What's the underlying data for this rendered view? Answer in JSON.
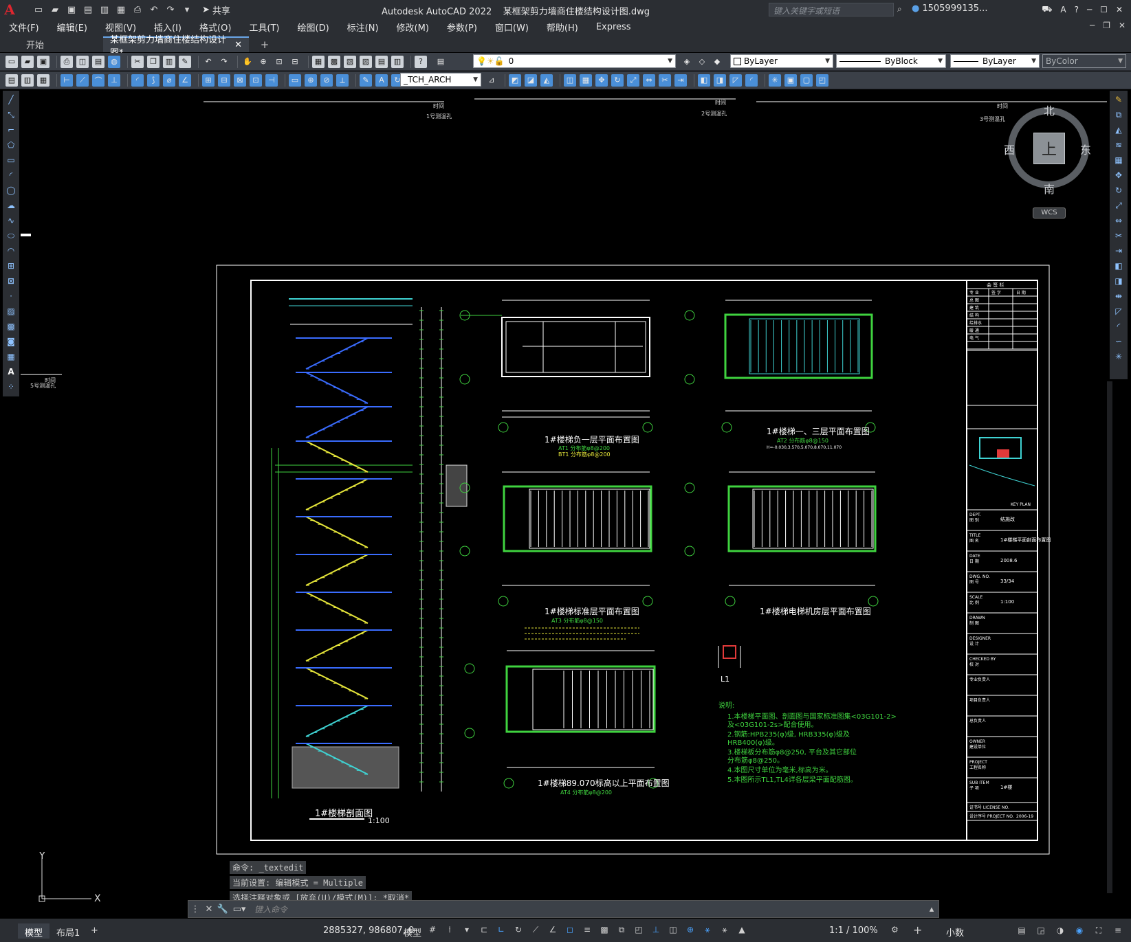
{
  "app": {
    "logo": "A",
    "title": "Autodesk AutoCAD 2022",
    "filename": "某框架剪力墙商住楼结构设计图.dwg",
    "share_label": "共享",
    "search_placeholder": "键入关键字或短语",
    "user": "1505999135..."
  },
  "menu": [
    "文件(F)",
    "编辑(E)",
    "视图(V)",
    "插入(I)",
    "格式(O)",
    "工具(T)",
    "绘图(D)",
    "标注(N)",
    "修改(M)",
    "参数(P)",
    "窗口(W)",
    "帮助(H)",
    "Express"
  ],
  "tabs": {
    "start": "开始",
    "active": "某框架剪力墙商住楼结构设计图*",
    "close": "✕",
    "add": "+"
  },
  "toolbar": {
    "layer_value": "0",
    "text_style": "_TCH_ARCH",
    "color": "ByLayer",
    "linetype": "ByBlock",
    "lineweight": "ByLayer",
    "plotstyle": "ByColor"
  },
  "viewcube": {
    "north": "北",
    "south": "南",
    "east": "东",
    "west": "西",
    "top": "上",
    "wcs": "WCS"
  },
  "drawing": {
    "ruler_labels": [
      "1号测温孔",
      "2号测温孔",
      "3号测温孔",
      "5号测温孔"
    ],
    "ruler_time": "时间",
    "section_title": "1#楼梯剖面图",
    "section_scale": "1:100",
    "plans": [
      {
        "title": "1#楼梯负一层平面布置图",
        "note1": "AT1 分布筋φ8@200",
        "note2": "BT1 分布筋φ8@200"
      },
      {
        "title": "1#楼梯一、三层平面布置图",
        "note1": "AT2 分布筋φ8@150",
        "note2": "H=-0.030,3.570,5.070,8.070,11.070"
      },
      {
        "title": "1#楼梯标准层平面布置图",
        "note1": "AT3 分布筋φ8@150",
        "note2": ""
      },
      {
        "title": "1#楼梯电梯机房层平面布置图",
        "note1": "",
        "note2": ""
      },
      {
        "title": "1#楼梯89.070标高以上平面布置图",
        "note1": "AT4 分布筋φ8@200",
        "note2": ""
      }
    ],
    "detail_label": "L1",
    "notes_title": "说明:",
    "notes": [
      "1.本楼梯平面图、剖面图与国家标准图集<03G101-2>",
      "  及<03G101-2s>配合使用。",
      "2.钢筋:HPB235(φ)级, HRB335(φ)级及",
      "  HRB400(φ)级。",
      "3.楼梯板分布筋φ8@250, 平台及其它部位",
      "  分布筋φ8@250。",
      "4.本图尺寸单位为毫米,标高为米。",
      "5.本图所示TL1,TL4详各层梁平面配筋图。"
    ],
    "titleblock": {
      "sign_header": "会 签 栏",
      "sign_cols": [
        "专 业",
        "签 字",
        "日 期"
      ],
      "sign_rows": [
        "总 图",
        "建 筑",
        "结 构",
        "给排水",
        "暖 通",
        "电 气"
      ],
      "key_plan": "KEY PLAN",
      "rows": [
        {
          "label": "DEPT.\n图 别",
          "value": "结施改"
        },
        {
          "label": "TITLE\n图 名",
          "value": "1#楼梯平面剖面布置图"
        },
        {
          "label": "DATE\n日 期",
          "value": "2008.6"
        },
        {
          "label": "DWG. NO.\n图 号",
          "value": "33/34"
        },
        {
          "label": "SCALE\n比 例",
          "value": "1:100"
        },
        {
          "label": "DRAWN\n制 图",
          "value": ""
        },
        {
          "label": "DESIGNER\n设 计",
          "value": ""
        },
        {
          "label": "CHECKED BY\n校 对",
          "value": ""
        },
        {
          "label": "专业负责人",
          "value": ""
        },
        {
          "label": "项目负责人",
          "value": ""
        },
        {
          "label": "总负责人",
          "value": ""
        },
        {
          "label": "OWNER\n建设单位",
          "value": ""
        },
        {
          "label": "PROJECT\n工程名称",
          "value": ""
        },
        {
          "label": "SUB ITEM\n子 项",
          "value": "1#楼"
        }
      ],
      "license": "证书号 LICENSE NO.",
      "project_no_label": "设计序号 PROJECT NO.",
      "project_no": "2006-19"
    }
  },
  "command": {
    "history": [
      "命令: _textedit",
      "当前设置: 编辑模式 = Multiple",
      "选择注释对象或 [放弃(U)/模式(M)]: *取消*"
    ],
    "placeholder": "键入命令"
  },
  "status": {
    "layout_tabs": [
      "模型",
      "布局1"
    ],
    "add_tab": "+",
    "coords": "2885327, 986807, 0",
    "mode": "模型",
    "scale": "1:1 / 100%",
    "units": "小数"
  }
}
